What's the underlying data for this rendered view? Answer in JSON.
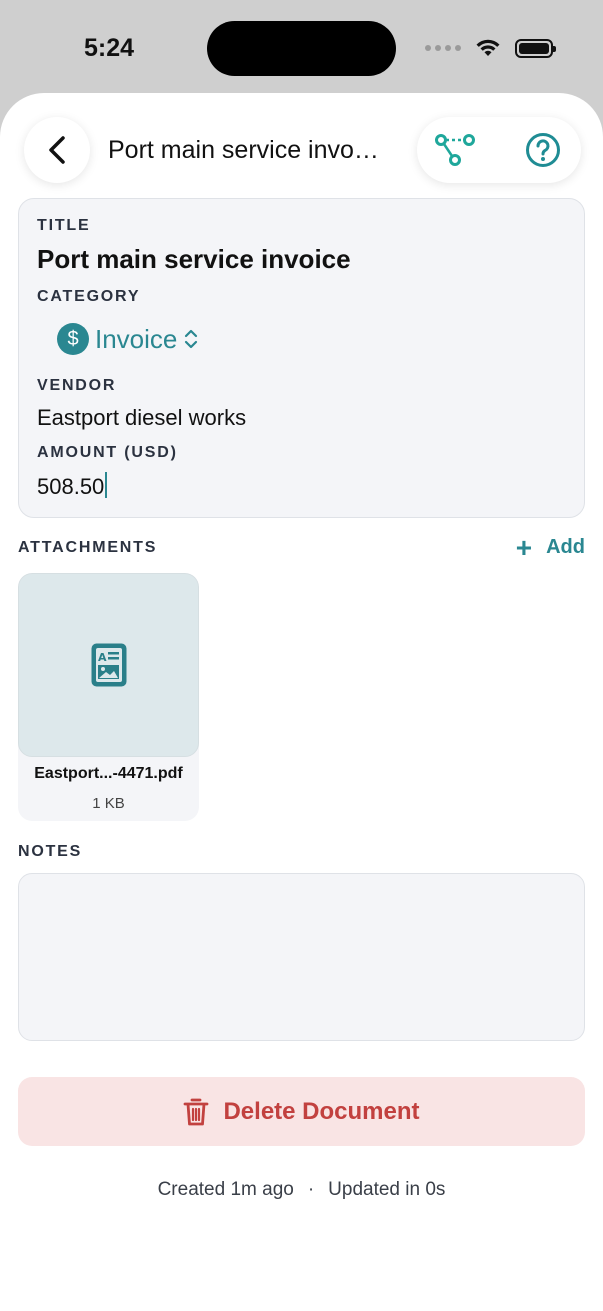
{
  "status_bar": {
    "time": "5:24"
  },
  "nav": {
    "title": "Port main service invo…"
  },
  "details": {
    "title_label": "TITLE",
    "title_value": "Port main service invoice",
    "category_label": "CATEGORY",
    "category_value": "Invoice",
    "vendor_label": "VENDOR",
    "vendor_value": "Eastport diesel works",
    "amount_label": "AMOUNT (USD)",
    "amount_value": "508.50"
  },
  "attachments": {
    "label": "ATTACHMENTS",
    "add_label": "Add",
    "items": [
      {
        "name": "Eastport...-4471.pdf",
        "size": "1 KB"
      }
    ]
  },
  "notes": {
    "label": "NOTES",
    "value": ""
  },
  "actions": {
    "delete_label": "Delete Document"
  },
  "footer": {
    "created": "Created 1m ago",
    "separator": "·",
    "updated": "Updated in 0s"
  },
  "colors": {
    "accent": "#2a8791",
    "danger": "#c2413f",
    "danger_bg": "#f9e4e4"
  }
}
